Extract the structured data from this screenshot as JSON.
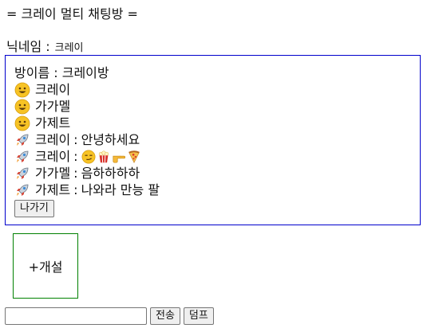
{
  "app": {
    "title": "= 크레이 멀티 채팅방 ="
  },
  "nickname": {
    "label": "닉네임 :",
    "value": "크레이"
  },
  "room": {
    "name_line": "방이름 : 크레이방",
    "members": [
      {
        "icon": "grinning-face-icon",
        "name": "크레이"
      },
      {
        "icon": "grinning-face-icon",
        "name": "가가멜"
      },
      {
        "icon": "grinning-face-icon",
        "name": "가제트"
      }
    ],
    "messages": [
      {
        "icon": "rocket-icon",
        "sender": "크레이",
        "separator": ":",
        "text": "안녕하세요"
      },
      {
        "icon": "rocket-icon",
        "sender": "크레이",
        "separator": ":",
        "emojis": [
          "smirking-face-icon",
          "popcorn-icon",
          "pointing-hand-icon",
          "pizza-icon"
        ]
      },
      {
        "icon": "rocket-icon",
        "sender": "가가멜",
        "separator": ":",
        "text": "음하하하하"
      },
      {
        "icon": "rocket-icon",
        "sender": "가제트",
        "separator": ":",
        "text": "나와라 만능 팔"
      }
    ],
    "leave_button": "나가기"
  },
  "create_room": {
    "label": "+개설"
  },
  "composer": {
    "input_value": "",
    "send_button": "전송",
    "dump_button": "덤프"
  },
  "colors": {
    "room_border": "#0000cc",
    "create_border": "#008000"
  }
}
